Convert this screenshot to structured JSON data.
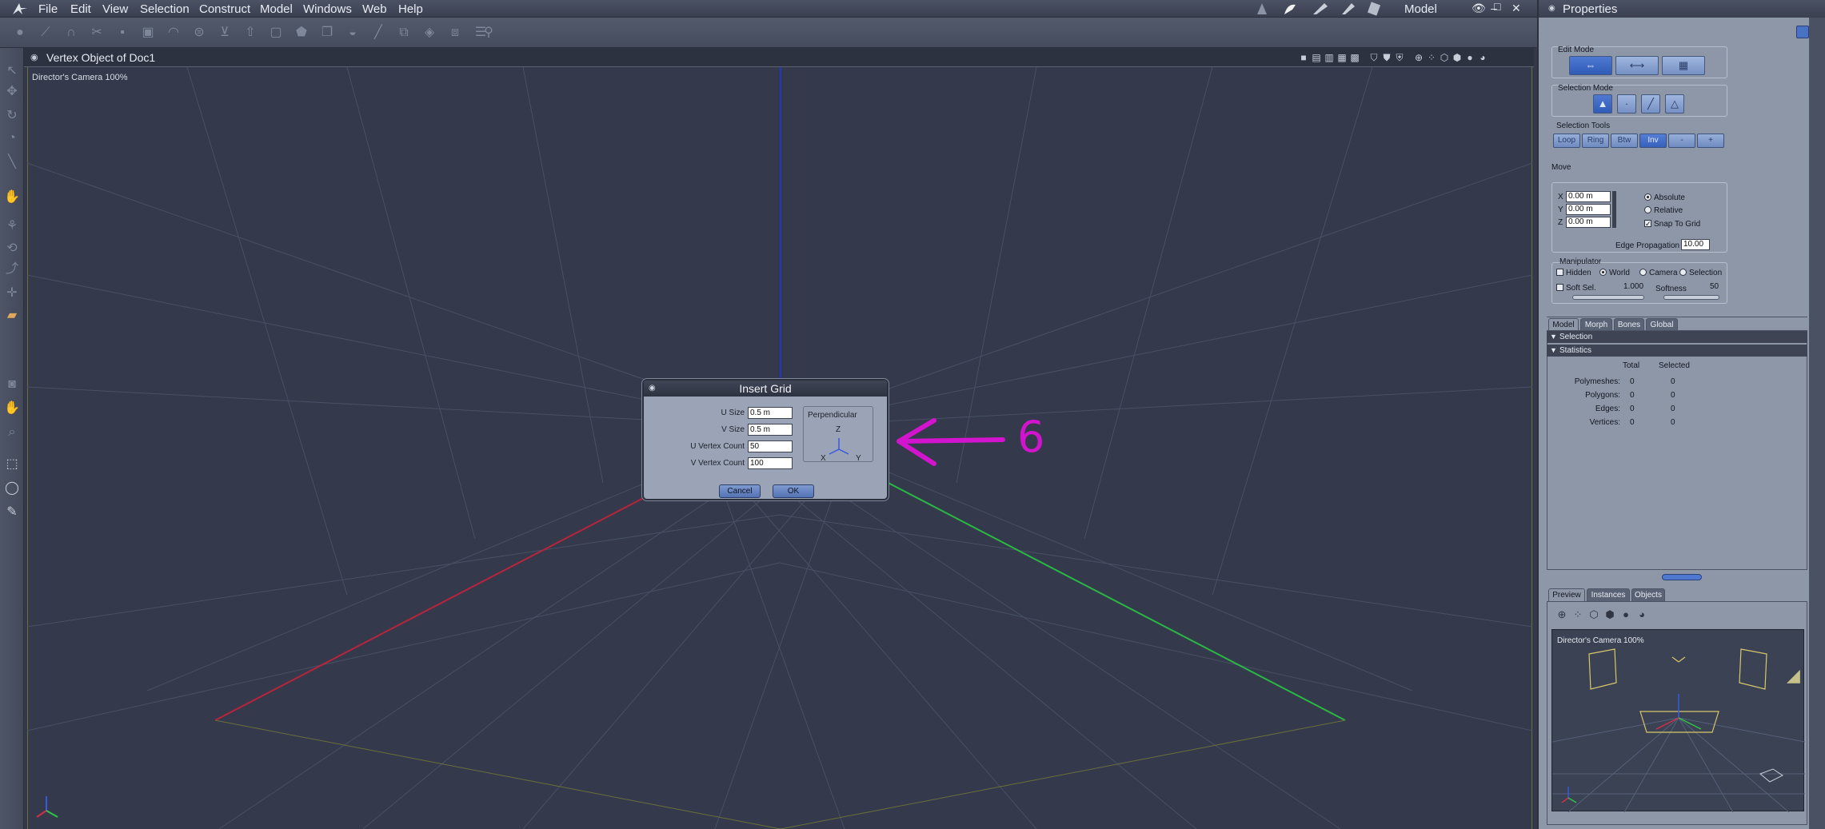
{
  "menubar": {
    "items": [
      "File",
      "Edit",
      "View",
      "Selection",
      "Construct",
      "Model",
      "Windows",
      "Web",
      "Help"
    ],
    "mode": "Model"
  },
  "viewport": {
    "title": "Vertex Object of Doc1",
    "camera_label": "Director's Camera 100%"
  },
  "dialog": {
    "title": "Insert Grid",
    "fields": [
      {
        "label": "U Size",
        "value": "0.5 m"
      },
      {
        "label": "V Size",
        "value": "0.5 m"
      },
      {
        "label": "U Vertex Count",
        "value": "50"
      },
      {
        "label": "V Vertex Count",
        "value": "100"
      }
    ],
    "perpendicular_label": "Perpendicular",
    "axes": {
      "z": "Z",
      "x": "X",
      "y": "Y"
    },
    "cancel": "Cancel",
    "ok": "OK"
  },
  "annotation": {
    "number": "6",
    "color": "#d214ce"
  },
  "properties": {
    "title": "Properties",
    "edit_mode": "Edit Mode",
    "selection_mode": "Selection Mode",
    "selection_tools": "Selection Tools",
    "sel_tool_buttons": [
      "Loop",
      "Ring",
      "Btw",
      "Inv",
      "-",
      "+"
    ],
    "move": "Move",
    "x_label": "X",
    "x_value": "0.00 m",
    "y_label": "Y",
    "y_value": "0.00 m",
    "z_label": "Z",
    "z_value": "0.00 m",
    "absolute": "Absolute",
    "relative": "Relative",
    "snap_to_grid": "Snap To Grid",
    "edge_propagation": "Edge Propagation",
    "edge_propagation_value": "10.00",
    "manipulator": "Manipulator",
    "hidden": "Hidden",
    "world": "World",
    "camera": "Camera",
    "selection": "Selection",
    "soft_sel": "Soft Sel.",
    "soft_sel_value": "1.000",
    "softness": "Softness",
    "softness_value": "50",
    "tabs": [
      "Model",
      "Morph",
      "Bones",
      "Global"
    ],
    "section_selection": "Selection",
    "section_statistics": "Statistics",
    "col_total": "Total",
    "col_selected": "Selected",
    "stats": [
      {
        "label": "Polymeshes:",
        "total": "0",
        "selected": "0"
      },
      {
        "label": "Polygons:",
        "total": "0",
        "selected": "0"
      },
      {
        "label": "Edges:",
        "total": "0",
        "selected": "0"
      },
      {
        "label": "Vertices:",
        "total": "0",
        "selected": "0"
      }
    ],
    "bottom_tabs": [
      "Preview",
      "Instances",
      "Objects"
    ],
    "preview_camera": "Director's Camera 100%"
  }
}
